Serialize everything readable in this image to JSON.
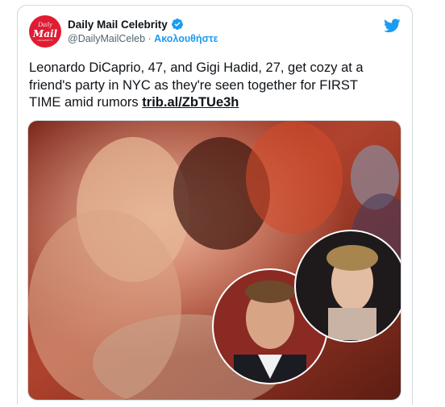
{
  "account": {
    "display_name": "Daily Mail Celebrity",
    "handle": "@DailyMailCeleb",
    "separator": " · ",
    "follow_label": "Ακολουθήστε",
    "avatar_text_top": "Daily",
    "avatar_text_main": "Mail",
    "avatar_text_bottom": "CELEBRITY"
  },
  "tweet": {
    "text": "Leonardo DiCaprio, 47, and Gigi Hadid, 27, get cozy at a friend's party in NYC as they're seen together for FIRST TIME amid rumors ",
    "link": "trib.al/ZbTUe3h"
  },
  "icons": {
    "verified": "verified-badge-icon",
    "platform": "twitter-bird-icon"
  },
  "colors": {
    "accent": "#1d9bf0",
    "avatar_bg": "#e01c33",
    "text": "#0f1419",
    "secondary_text": "#536471",
    "border": "#cfd9de"
  }
}
